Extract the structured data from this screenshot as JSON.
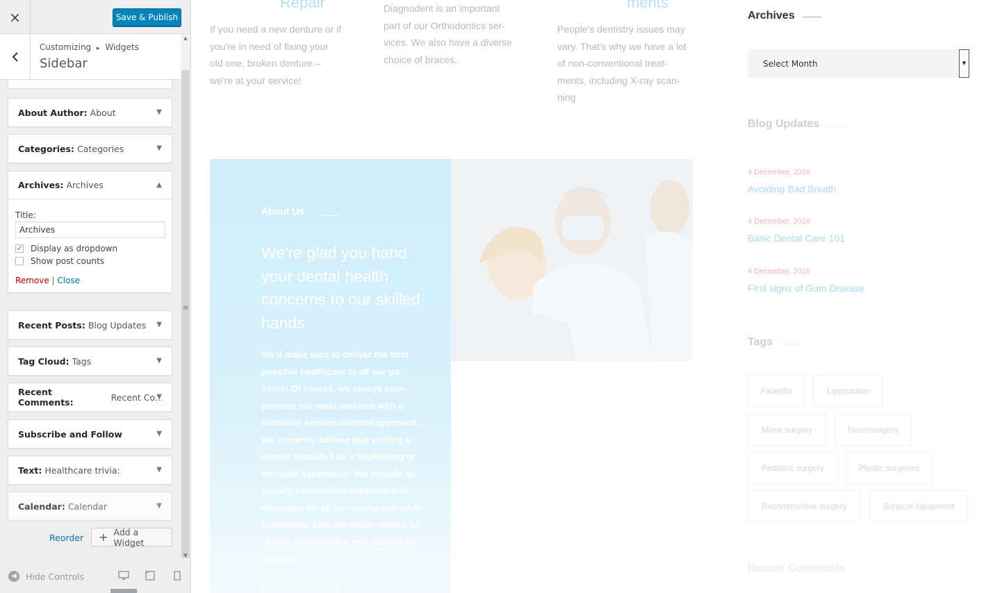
{
  "customizer": {
    "close_glyph": "×",
    "save_label": "Save & Publish",
    "back_glyph": "‹",
    "breadcrumb_root": "Customizing",
    "breadcrumb_sep": "▸",
    "breadcrumb_leaf": "Widgets",
    "section_title": "Sidebar",
    "widgets": [
      {
        "type": "About Author:",
        "name": "About"
      },
      {
        "type": "Categories:",
        "name": "Categories"
      },
      {
        "type": "Archives:",
        "name": "Archives"
      },
      {
        "type": "Recent Posts:",
        "name": "Blog Updates"
      },
      {
        "type": "Tag Cloud:",
        "name": "Tags"
      },
      {
        "type": "Recent Comments:",
        "name": "Recent Co..."
      },
      {
        "type": "Subscribe and Follow",
        "name": ""
      },
      {
        "type": "Text:",
        "name": "Healthcare trivia:"
      },
      {
        "type": "Calendar:",
        "name": "Calendar"
      }
    ],
    "archives_form": {
      "title_label": "Title:",
      "title_value": "Archives",
      "dropdown_label": "Display as dropdown",
      "dropdown_checked": true,
      "counts_label": "Show post counts",
      "counts_checked": false,
      "remove_label": "Remove",
      "sep": "|",
      "close_label": "Close"
    },
    "reorder_label": "Reorder",
    "add_widget_label": "Add a Widget",
    "hide_controls_label": "Hide Controls",
    "accent": "#0085ba"
  },
  "preview": {
    "services": [
      {
        "heading": "Repair",
        "text": [
          "If you need a new denture or if",
          "you're in need of fixing your",
          "old one, broken denture –",
          "we're at your service!"
        ]
      },
      {
        "heading": "",
        "text": [
          "Diagnodent is an important",
          "part of our Orthodontics ser-",
          "vices. We also have a diverse",
          "choice of braces."
        ]
      },
      {
        "heading": "ments",
        "text": [
          "People's dentistry issues may",
          "vary. That's why we have a lot",
          "of non-conventional treat-",
          "ments, including X-ray scan-",
          "ning"
        ]
      }
    ],
    "about": {
      "subtitle": "About Us",
      "headline": "We're glad you hand your dental health concerns to our skilled hands.",
      "body": "We'll make sure to deliver the best possible healthcare to all our pa- tients! Of course, we always com- plement our main services with a customer service oriented approach. We sincerely believe that visiting a dentist shouldn't be a frightening or stressful experience! We provide an equally comfortable experience of relaxation for all our young and adult customers! Also we imple- ment a lot of pain management and anesthesia options."
    },
    "sidebar": {
      "archives_title": "Archives",
      "archives_select": "Select Month",
      "blog_title": "Blog Updates",
      "posts": [
        {
          "date": "4 December, 2016",
          "title": "Avoiding Bad Breath"
        },
        {
          "date": "4 December, 2016",
          "title": "Basic Dental Care 101"
        },
        {
          "date": "4 December, 2016",
          "title": "First signs of Gum Disease"
        }
      ],
      "tags_title": "Tags",
      "tags": [
        "Facelifts",
        "Liposuction",
        "Minor surgery",
        "Neurosurgery",
        "Pediatric surgery",
        "Plastic surgeries",
        "Reconstructive surgery",
        "Surgical equipment"
      ],
      "comments_title": "Recent Comments"
    }
  }
}
